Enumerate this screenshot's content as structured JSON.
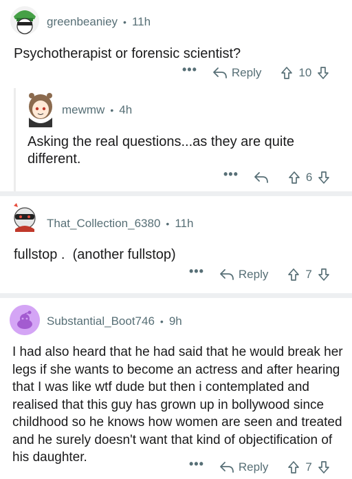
{
  "comments": [
    {
      "username": "greenbeaniey",
      "time": "11h",
      "body": "Psychotherapist or forensic scientist?",
      "more": "•••",
      "reply_label": "Reply",
      "votes": "10"
    },
    {
      "username": "mewmw",
      "time": "4h",
      "body": "Asking the real questions...as they are quite different.",
      "more": "•••",
      "votes": "6"
    },
    {
      "username": "That_Collection_6380",
      "time": "11h",
      "body": "fullstop .  (another fullstop)",
      "more": "•••",
      "reply_label": "Reply",
      "votes": "7"
    },
    {
      "username": "Substantial_Boot746",
      "time": "9h",
      "body": "I had also heard that he had said that he would break her legs if she wants to become an actress and after hearing that I was like wtf dude but then i contemplated and realised that this guy has grown up in bollywood since childhood so he knows how women are seen and treated and he surely doesn't want that kind of objectification of his daughter.",
      "more": "•••",
      "reply_label": "Reply",
      "votes": "7"
    }
  ],
  "colors": {
    "meta": "#576f76",
    "text": "#1a1a1b",
    "separator": "#edeff1",
    "avatar_purple": "#d4a5f5"
  }
}
